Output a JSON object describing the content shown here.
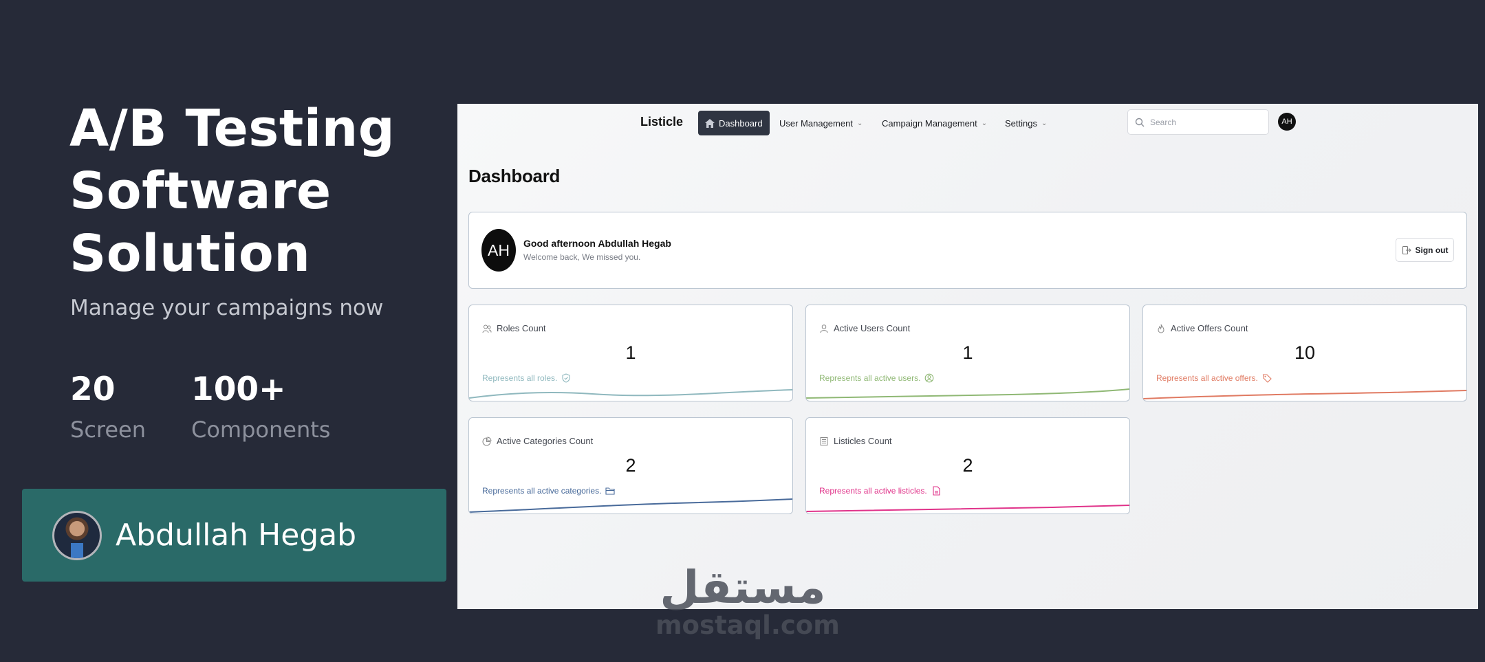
{
  "promo": {
    "title": "A/B Testing Software Solution",
    "subtitle": "Manage your campaigns now",
    "stats": [
      {
        "value": "20",
        "label": "Screen"
      },
      {
        "value": "100+",
        "label": "Components"
      }
    ],
    "author": {
      "name": "Abdullah Hegab"
    }
  },
  "app": {
    "brand": "Listicle",
    "nav": [
      {
        "label": "Dashboard",
        "active": true
      },
      {
        "label": "User Management",
        "dropdown": true
      },
      {
        "label": "Campaign Management",
        "dropdown": true
      },
      {
        "label": "Settings",
        "dropdown": true
      }
    ],
    "search": {
      "placeholder": "Search",
      "value": ""
    },
    "user_initials": "AH",
    "page_title": "Dashboard",
    "welcome": {
      "initials": "AH",
      "greeting": "Good afternoon Abdullah Hegab",
      "message": "Welcome back, We missed you.",
      "signout_label": "Sign out"
    },
    "cards": [
      {
        "title": "Roles Count",
        "value": "1",
        "footer": "Represents all roles.",
        "color": "#8fb8be",
        "icon": "roles-icon",
        "foot_icon": "shield-check-icon"
      },
      {
        "title": "Active Users Count",
        "value": "1",
        "footer": "Represents all active users.",
        "color": "#8fb874",
        "icon": "user-icon",
        "foot_icon": "user-circle-icon"
      },
      {
        "title": "Active Offers Count",
        "value": "10",
        "footer": "Represents all active offers.",
        "color": "#e07a62",
        "icon": "flame-icon",
        "foot_icon": "tag-icon"
      },
      {
        "title": "Active Categories Count",
        "value": "2",
        "footer": "Represents all active categories.",
        "color": "#486a9a",
        "icon": "pie-icon",
        "foot_icon": "folder-icon"
      },
      {
        "title": "Listicles Count",
        "value": "2",
        "footer": "Represents all active listicles.",
        "color": "#e0338a",
        "icon": "list-icon",
        "foot_icon": "file-icon"
      }
    ]
  },
  "watermark": {
    "arabic": "مستقل",
    "latin": "mostaql.com"
  }
}
